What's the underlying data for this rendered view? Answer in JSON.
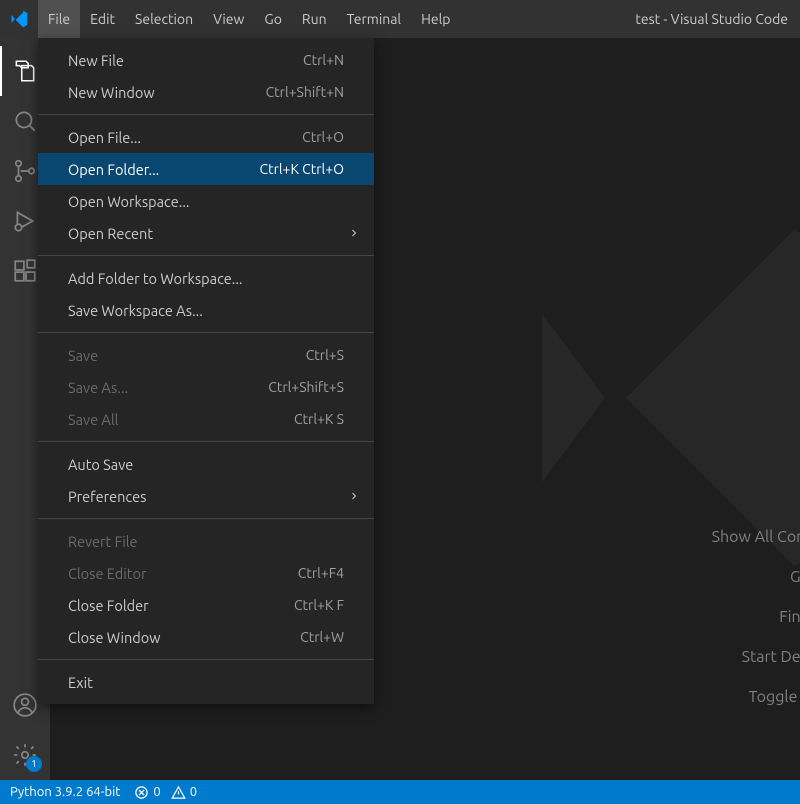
{
  "window_title": "test - Visual Studio Code",
  "menubar": {
    "items": [
      {
        "label": "File",
        "active": true
      },
      {
        "label": "Edit"
      },
      {
        "label": "Selection"
      },
      {
        "label": "View"
      },
      {
        "label": "Go"
      },
      {
        "label": "Run"
      },
      {
        "label": "Terminal"
      },
      {
        "label": "Help"
      }
    ]
  },
  "file_menu": [
    {
      "type": "item",
      "label": "New File",
      "shortcut": "Ctrl+N"
    },
    {
      "type": "item",
      "label": "New Window",
      "shortcut": "Ctrl+Shift+N"
    },
    {
      "type": "sep"
    },
    {
      "type": "item",
      "label": "Open File...",
      "shortcut": "Ctrl+O"
    },
    {
      "type": "item",
      "label": "Open Folder...",
      "shortcut": "Ctrl+K Ctrl+O",
      "highlight": true
    },
    {
      "type": "item",
      "label": "Open Workspace..."
    },
    {
      "type": "item",
      "label": "Open Recent",
      "submenu": true
    },
    {
      "type": "sep"
    },
    {
      "type": "item",
      "label": "Add Folder to Workspace..."
    },
    {
      "type": "item",
      "label": "Save Workspace As..."
    },
    {
      "type": "sep"
    },
    {
      "type": "item",
      "label": "Save",
      "shortcut": "Ctrl+S",
      "disabled": true
    },
    {
      "type": "item",
      "label": "Save As...",
      "shortcut": "Ctrl+Shift+S",
      "disabled": true
    },
    {
      "type": "item",
      "label": "Save All",
      "shortcut": "Ctrl+K S",
      "disabled": true
    },
    {
      "type": "sep"
    },
    {
      "type": "item",
      "label": "Auto Save"
    },
    {
      "type": "item",
      "label": "Preferences",
      "submenu": true
    },
    {
      "type": "sep"
    },
    {
      "type": "item",
      "label": "Revert File",
      "disabled": true
    },
    {
      "type": "item",
      "label": "Close Editor",
      "shortcut": "Ctrl+F4",
      "disabled": true
    },
    {
      "type": "item",
      "label": "Close Folder",
      "shortcut": "Ctrl+K F"
    },
    {
      "type": "item",
      "label": "Close Window",
      "shortcut": "Ctrl+W"
    },
    {
      "type": "sep"
    },
    {
      "type": "item",
      "label": "Exit"
    }
  ],
  "activitybar": {
    "top": [
      "explorer",
      "search",
      "source-control",
      "run-debug",
      "extensions"
    ],
    "bottom": [
      "accounts",
      "settings"
    ],
    "settings_badge": "1"
  },
  "editor_shortcuts": [
    "Show All Com",
    "Go",
    "Find",
    "Start Deb",
    "Toggle T"
  ],
  "statusbar": {
    "python": "Python 3.9.2 64-bit",
    "errors": "0",
    "warnings": "0"
  }
}
